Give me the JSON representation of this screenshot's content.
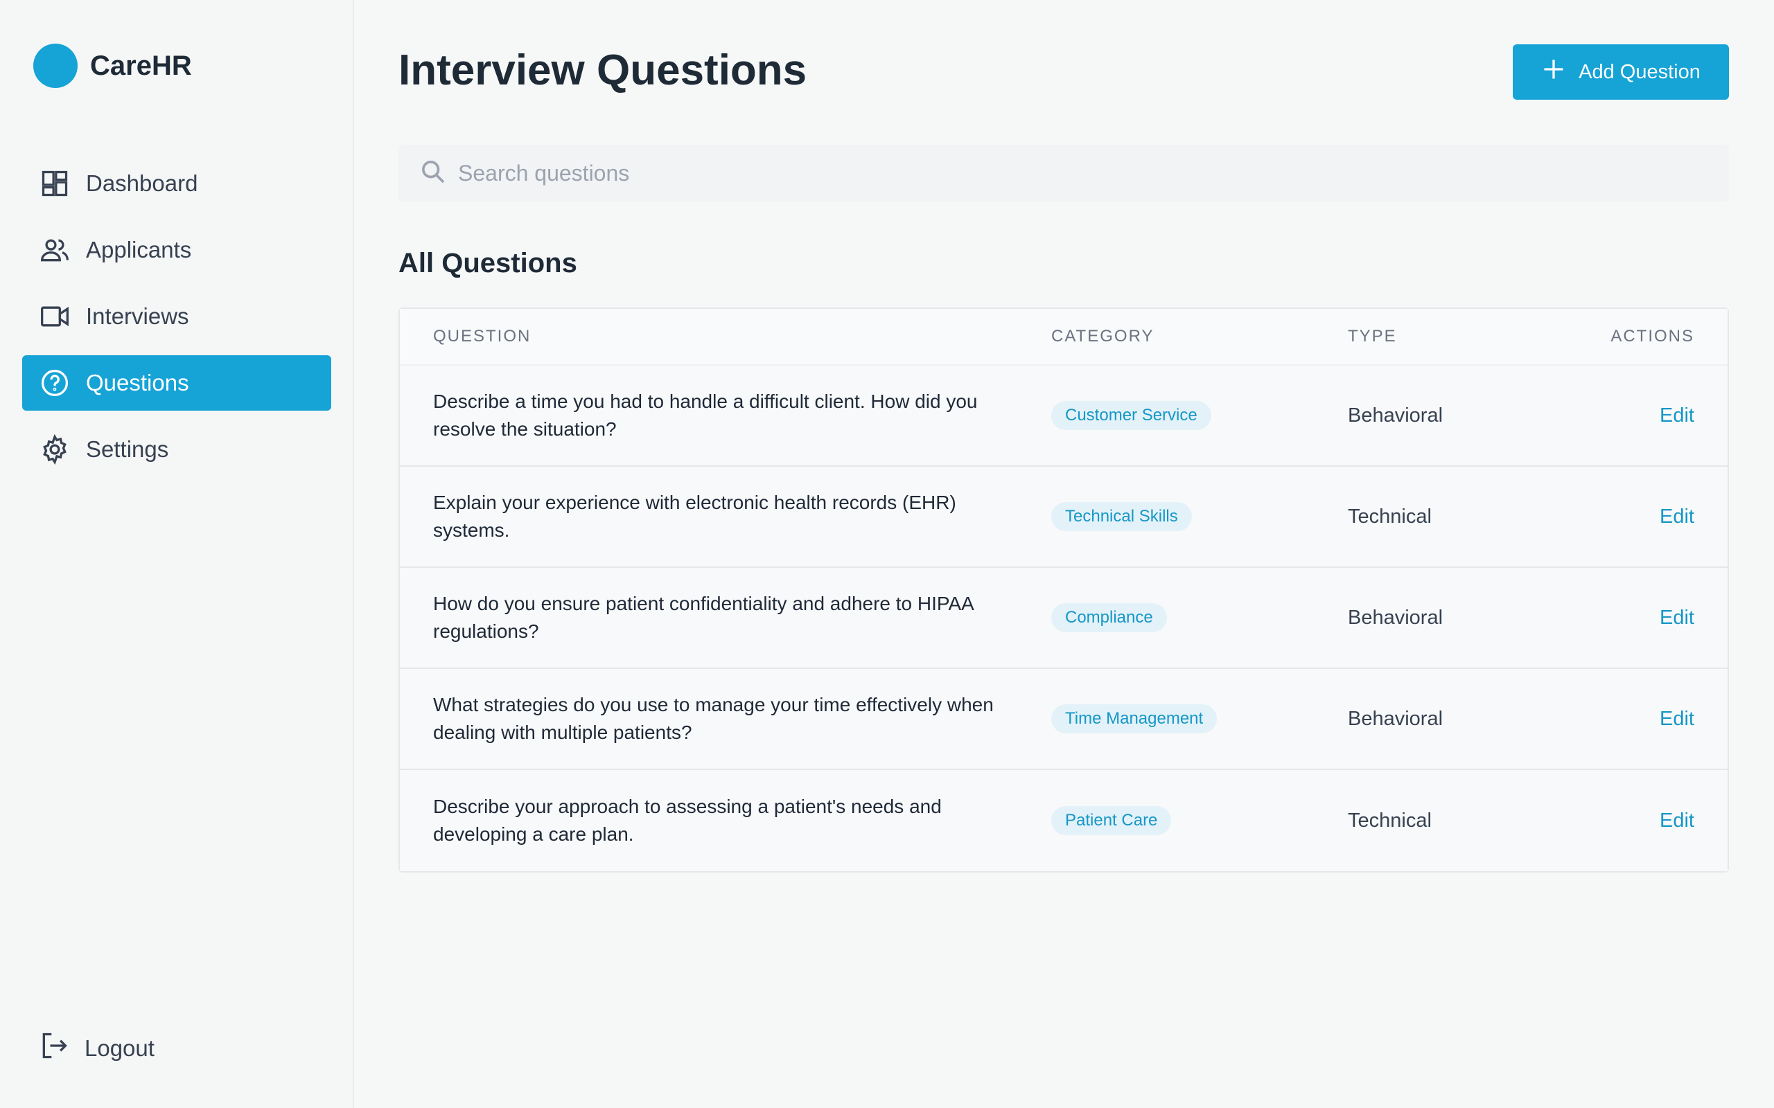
{
  "brand": {
    "name": "CareHR",
    "color": "#16a3d6"
  },
  "sidebar": {
    "items": [
      {
        "label": "Dashboard",
        "icon": "dashboard-icon",
        "active": false
      },
      {
        "label": "Applicants",
        "icon": "users-icon",
        "active": false
      },
      {
        "label": "Interviews",
        "icon": "video-icon",
        "active": false
      },
      {
        "label": "Questions",
        "icon": "question-circle-icon",
        "active": true
      },
      {
        "label": "Settings",
        "icon": "gear-icon",
        "active": false
      }
    ],
    "logout_label": "Logout"
  },
  "header": {
    "title": "Interview Questions",
    "add_button_label": "Add Question"
  },
  "search": {
    "placeholder": "Search questions",
    "value": ""
  },
  "section_title": "All Questions",
  "table": {
    "headers": {
      "question": "QUESTION",
      "category": "CATEGORY",
      "type": "TYPE",
      "actions": "ACTIONS"
    },
    "rows": [
      {
        "question": "Describe a time you had to handle a difficult client. How did you resolve the situation?",
        "category": "Customer Service",
        "type": "Behavioral",
        "action": "Edit"
      },
      {
        "question": "Explain your experience with electronic health records (EHR) systems.",
        "category": "Technical Skills",
        "type": "Technical",
        "action": "Edit"
      },
      {
        "question": "How do you ensure patient confidentiality and adhere to HIPAA regulations?",
        "category": "Compliance",
        "type": "Behavioral",
        "action": "Edit"
      },
      {
        "question": "What strategies do you use to manage your time effectively when dealing with multiple patients?",
        "category": "Time Management",
        "type": "Behavioral",
        "action": "Edit"
      },
      {
        "question": "Describe your approach to assessing a patient's needs and developing a care plan.",
        "category": "Patient Care",
        "type": "Technical",
        "action": "Edit"
      }
    ]
  },
  "colors": {
    "accent": "#16a3d6",
    "badge_bg": "#e3f2f8",
    "badge_text": "#1597c7"
  }
}
